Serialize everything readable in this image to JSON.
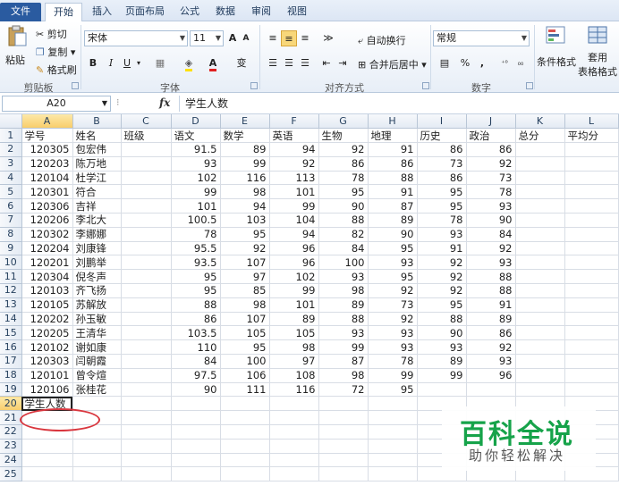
{
  "ribbon": {
    "tabs": [
      "文件",
      "开始",
      "插入",
      "页面布局",
      "公式",
      "数据",
      "审阅",
      "视图"
    ],
    "clipboard": {
      "paste": "粘贴",
      "cut": "剪切",
      "copy": "复制",
      "format_painter": "格式刷",
      "label": "剪贴板"
    },
    "font": {
      "name": "宋体",
      "size": "11",
      "grow": "A",
      "shrink": "A",
      "bold": "B",
      "italic": "I",
      "underline": "U",
      "label": "字体",
      "color_mark": "A",
      "phonetic": "变"
    },
    "alignment": {
      "wrap": "自动换行",
      "merge": "合并后居中",
      "label": "对齐方式"
    },
    "number": {
      "format": "常规",
      "percent": "%",
      "comma": ",",
      "label": "数字"
    },
    "styles": {
      "conditional": "条件格式",
      "table1": "套用",
      "table2": "表格格式"
    }
  },
  "formula_bar": {
    "name_box": "A20",
    "fx": "fx",
    "content": "学生人数"
  },
  "columns": [
    "A",
    "B",
    "C",
    "D",
    "E",
    "F",
    "G",
    "H",
    "I",
    "J",
    "K",
    "L"
  ],
  "rows": [
    [
      "学号",
      "姓名",
      "班级",
      "语文",
      "数学",
      "英语",
      "生物",
      "地理",
      "历史",
      "政治",
      "总分",
      "平均分"
    ],
    [
      "120305",
      "包宏伟",
      "",
      "91.5",
      "89",
      "94",
      "92",
      "91",
      "86",
      "86",
      "",
      ""
    ],
    [
      "120203",
      "陈万地",
      "",
      "93",
      "99",
      "92",
      "86",
      "86",
      "73",
      "92",
      "",
      ""
    ],
    [
      "120104",
      "杜学江",
      "",
      "102",
      "116",
      "113",
      "78",
      "88",
      "86",
      "73",
      "",
      ""
    ],
    [
      "120301",
      "符合",
      "",
      "99",
      "98",
      "101",
      "95",
      "91",
      "95",
      "78",
      "",
      ""
    ],
    [
      "120306",
      "吉祥",
      "",
      "101",
      "94",
      "99",
      "90",
      "87",
      "95",
      "93",
      "",
      ""
    ],
    [
      "120206",
      "李北大",
      "",
      "100.5",
      "103",
      "104",
      "88",
      "89",
      "78",
      "90",
      "",
      ""
    ],
    [
      "120302",
      "李娜娜",
      "",
      "78",
      "95",
      "94",
      "82",
      "90",
      "93",
      "84",
      "",
      ""
    ],
    [
      "120204",
      "刘康锋",
      "",
      "95.5",
      "92",
      "96",
      "84",
      "95",
      "91",
      "92",
      "",
      ""
    ],
    [
      "120201",
      "刘鹏举",
      "",
      "93.5",
      "107",
      "96",
      "100",
      "93",
      "92",
      "93",
      "",
      ""
    ],
    [
      "120304",
      "倪冬声",
      "",
      "95",
      "97",
      "102",
      "93",
      "95",
      "92",
      "88",
      "",
      ""
    ],
    [
      "120103",
      "齐飞扬",
      "",
      "95",
      "85",
      "99",
      "98",
      "92",
      "92",
      "88",
      "",
      ""
    ],
    [
      "120105",
      "苏解放",
      "",
      "88",
      "98",
      "101",
      "89",
      "73",
      "95",
      "91",
      "",
      ""
    ],
    [
      "120202",
      "孙玉敏",
      "",
      "86",
      "107",
      "89",
      "88",
      "92",
      "88",
      "89",
      "",
      ""
    ],
    [
      "120205",
      "王清华",
      "",
      "103.5",
      "105",
      "105",
      "93",
      "93",
      "90",
      "86",
      "",
      ""
    ],
    [
      "120102",
      "谢如康",
      "",
      "110",
      "95",
      "98",
      "99",
      "93",
      "93",
      "92",
      "",
      ""
    ],
    [
      "120303",
      "闫朝霞",
      "",
      "84",
      "100",
      "97",
      "87",
      "78",
      "89",
      "93",
      "",
      ""
    ],
    [
      "120101",
      "曾令煊",
      "",
      "97.5",
      "106",
      "108",
      "98",
      "99",
      "99",
      "96",
      "",
      ""
    ],
    [
      "120106",
      "张桂花",
      "",
      "90",
      "111",
      "116",
      "72",
      "95",
      "",
      "",
      "",
      ""
    ],
    [
      "学生人数",
      "",
      "",
      "",
      "",
      "",
      "",
      "",
      "",
      "",
      "",
      ""
    ],
    [
      "",
      "",
      "",
      "",
      "",
      "",
      "",
      "",
      "",
      "",
      "",
      ""
    ],
    [
      "",
      "",
      "",
      "",
      "",
      "",
      "",
      "",
      "",
      "",
      "",
      ""
    ],
    [
      "",
      "",
      "",
      "",
      "",
      "",
      "",
      "",
      "",
      "",
      "",
      ""
    ],
    [
      "",
      "",
      "",
      "",
      "",
      "",
      "",
      "",
      "",
      "",
      "",
      ""
    ],
    [
      "",
      "",
      "",
      "",
      "",
      "",
      "",
      "",
      "",
      "",
      "",
      ""
    ]
  ],
  "watermark": {
    "title": "百科全说",
    "subtitle": "助你轻松解决"
  },
  "colors": {
    "accent": "#2a5ba0",
    "selection": "#f8cd6b",
    "annotation": "#d9363e",
    "watermark": "#16a34a"
  }
}
